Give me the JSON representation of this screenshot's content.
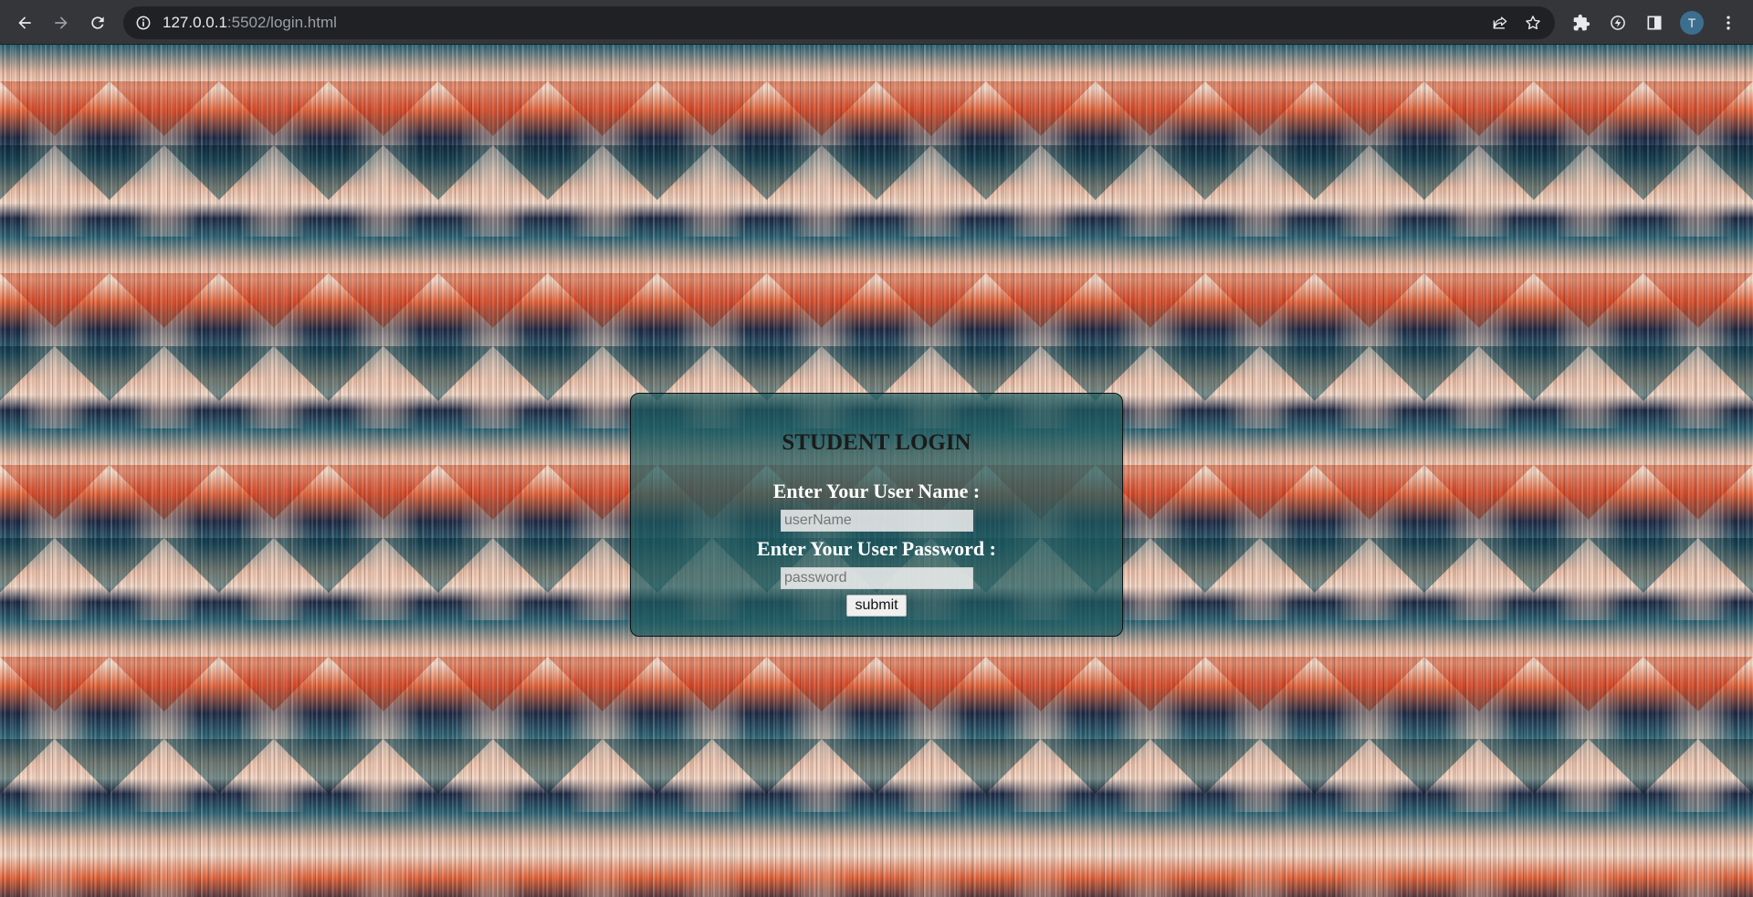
{
  "browser": {
    "url_host": "127.0.0.1",
    "url_rest": ":5502/login.html",
    "profile_initial": "T",
    "icons": {
      "back": "back-arrow-icon",
      "forward": "forward-arrow-icon",
      "reload": "reload-icon",
      "site_info": "info-icon",
      "share": "share-icon",
      "bookmark": "star-icon",
      "extensions": "puzzle-icon",
      "performance": "lightning-icon",
      "side_panel": "side-panel-icon",
      "menu": "kebab-menu-icon"
    }
  },
  "login": {
    "title": "STUDENT LOGIN",
    "username_label": "Enter Your User Name :",
    "username_placeholder": "userName",
    "password_label": "Enter Your User Password :",
    "password_placeholder": "password",
    "submit_label": "submit"
  },
  "colors": {
    "chrome_toolbar": "#35363a",
    "omnibox": "#202124",
    "card_background": "#1e5c60",
    "pattern_orange": "#e4643a",
    "pattern_teal": "#2d6677",
    "pattern_navy": "#1f2b46",
    "pattern_peach": "#f3d9c8"
  }
}
